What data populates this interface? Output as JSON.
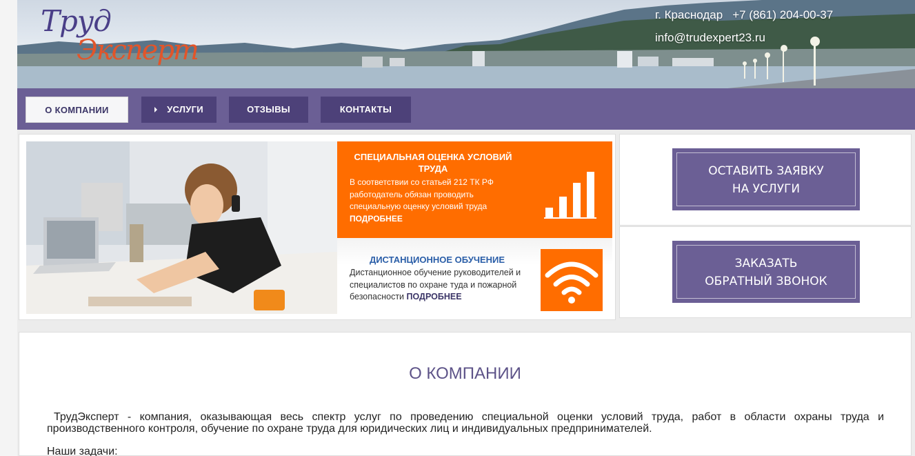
{
  "header": {
    "logo_line1": "Труд",
    "logo_line2": "Эксперт",
    "city": "г. Краснодар",
    "phone": "+7 (861) 204-00-37",
    "email": "info@trudexpert23.ru"
  },
  "nav": {
    "items": [
      {
        "label": "О КОМПАНИИ",
        "active": true
      },
      {
        "label": "УСЛУГИ",
        "active": false,
        "has_submenu": true
      },
      {
        "label": "ОТЗЫВЫ",
        "active": false
      },
      {
        "label": "КОНТАКТЫ",
        "active": false
      }
    ]
  },
  "promo1": {
    "title": "СПЕЦИАЛЬНАЯ ОЦЕНКА УСЛОВИЙ ТРУДА",
    "text": "В соответствии со статьей 212 ТК РФ работодатель обязан проводить специальную оценку условий труда",
    "more": "ПОДРОБНЕЕ",
    "icon": "bar-chart-icon"
  },
  "promo2": {
    "title": "ДИСТАНЦИОННОЕ ОБУЧЕНИЕ",
    "text": "Дистанционное обучение руководителей и специалистов по охране туда и пожарной безопасности",
    "more": "ПОДРОБНЕЕ",
    "icon": "wifi-icon"
  },
  "cards": {
    "request_line1": "ОСТАВИТЬ ЗАЯВКУ",
    "request_line2": "НА УСЛУГИ",
    "callback_line1": "ЗАКАЗАТЬ",
    "callback_line2": "ОБРАТНЫЙ ЗВОНОК"
  },
  "about": {
    "title": "О КОМПАНИИ",
    "paragraph": "ТрудЭксперт - компания, оказывающая весь спектр услуг по проведению специальной оценки условий труда, работ в области охраны труда и производственного контроля, обучение по охране труда для юридических лиц и индивидуальных предпринимателей.",
    "tasks_label": "Наши задачи:"
  },
  "colors": {
    "brand_purple": "#6b5f95",
    "nav_button": "#4d4179",
    "accent_orange": "#ff6d00",
    "link_blue": "#2a5ea8"
  }
}
